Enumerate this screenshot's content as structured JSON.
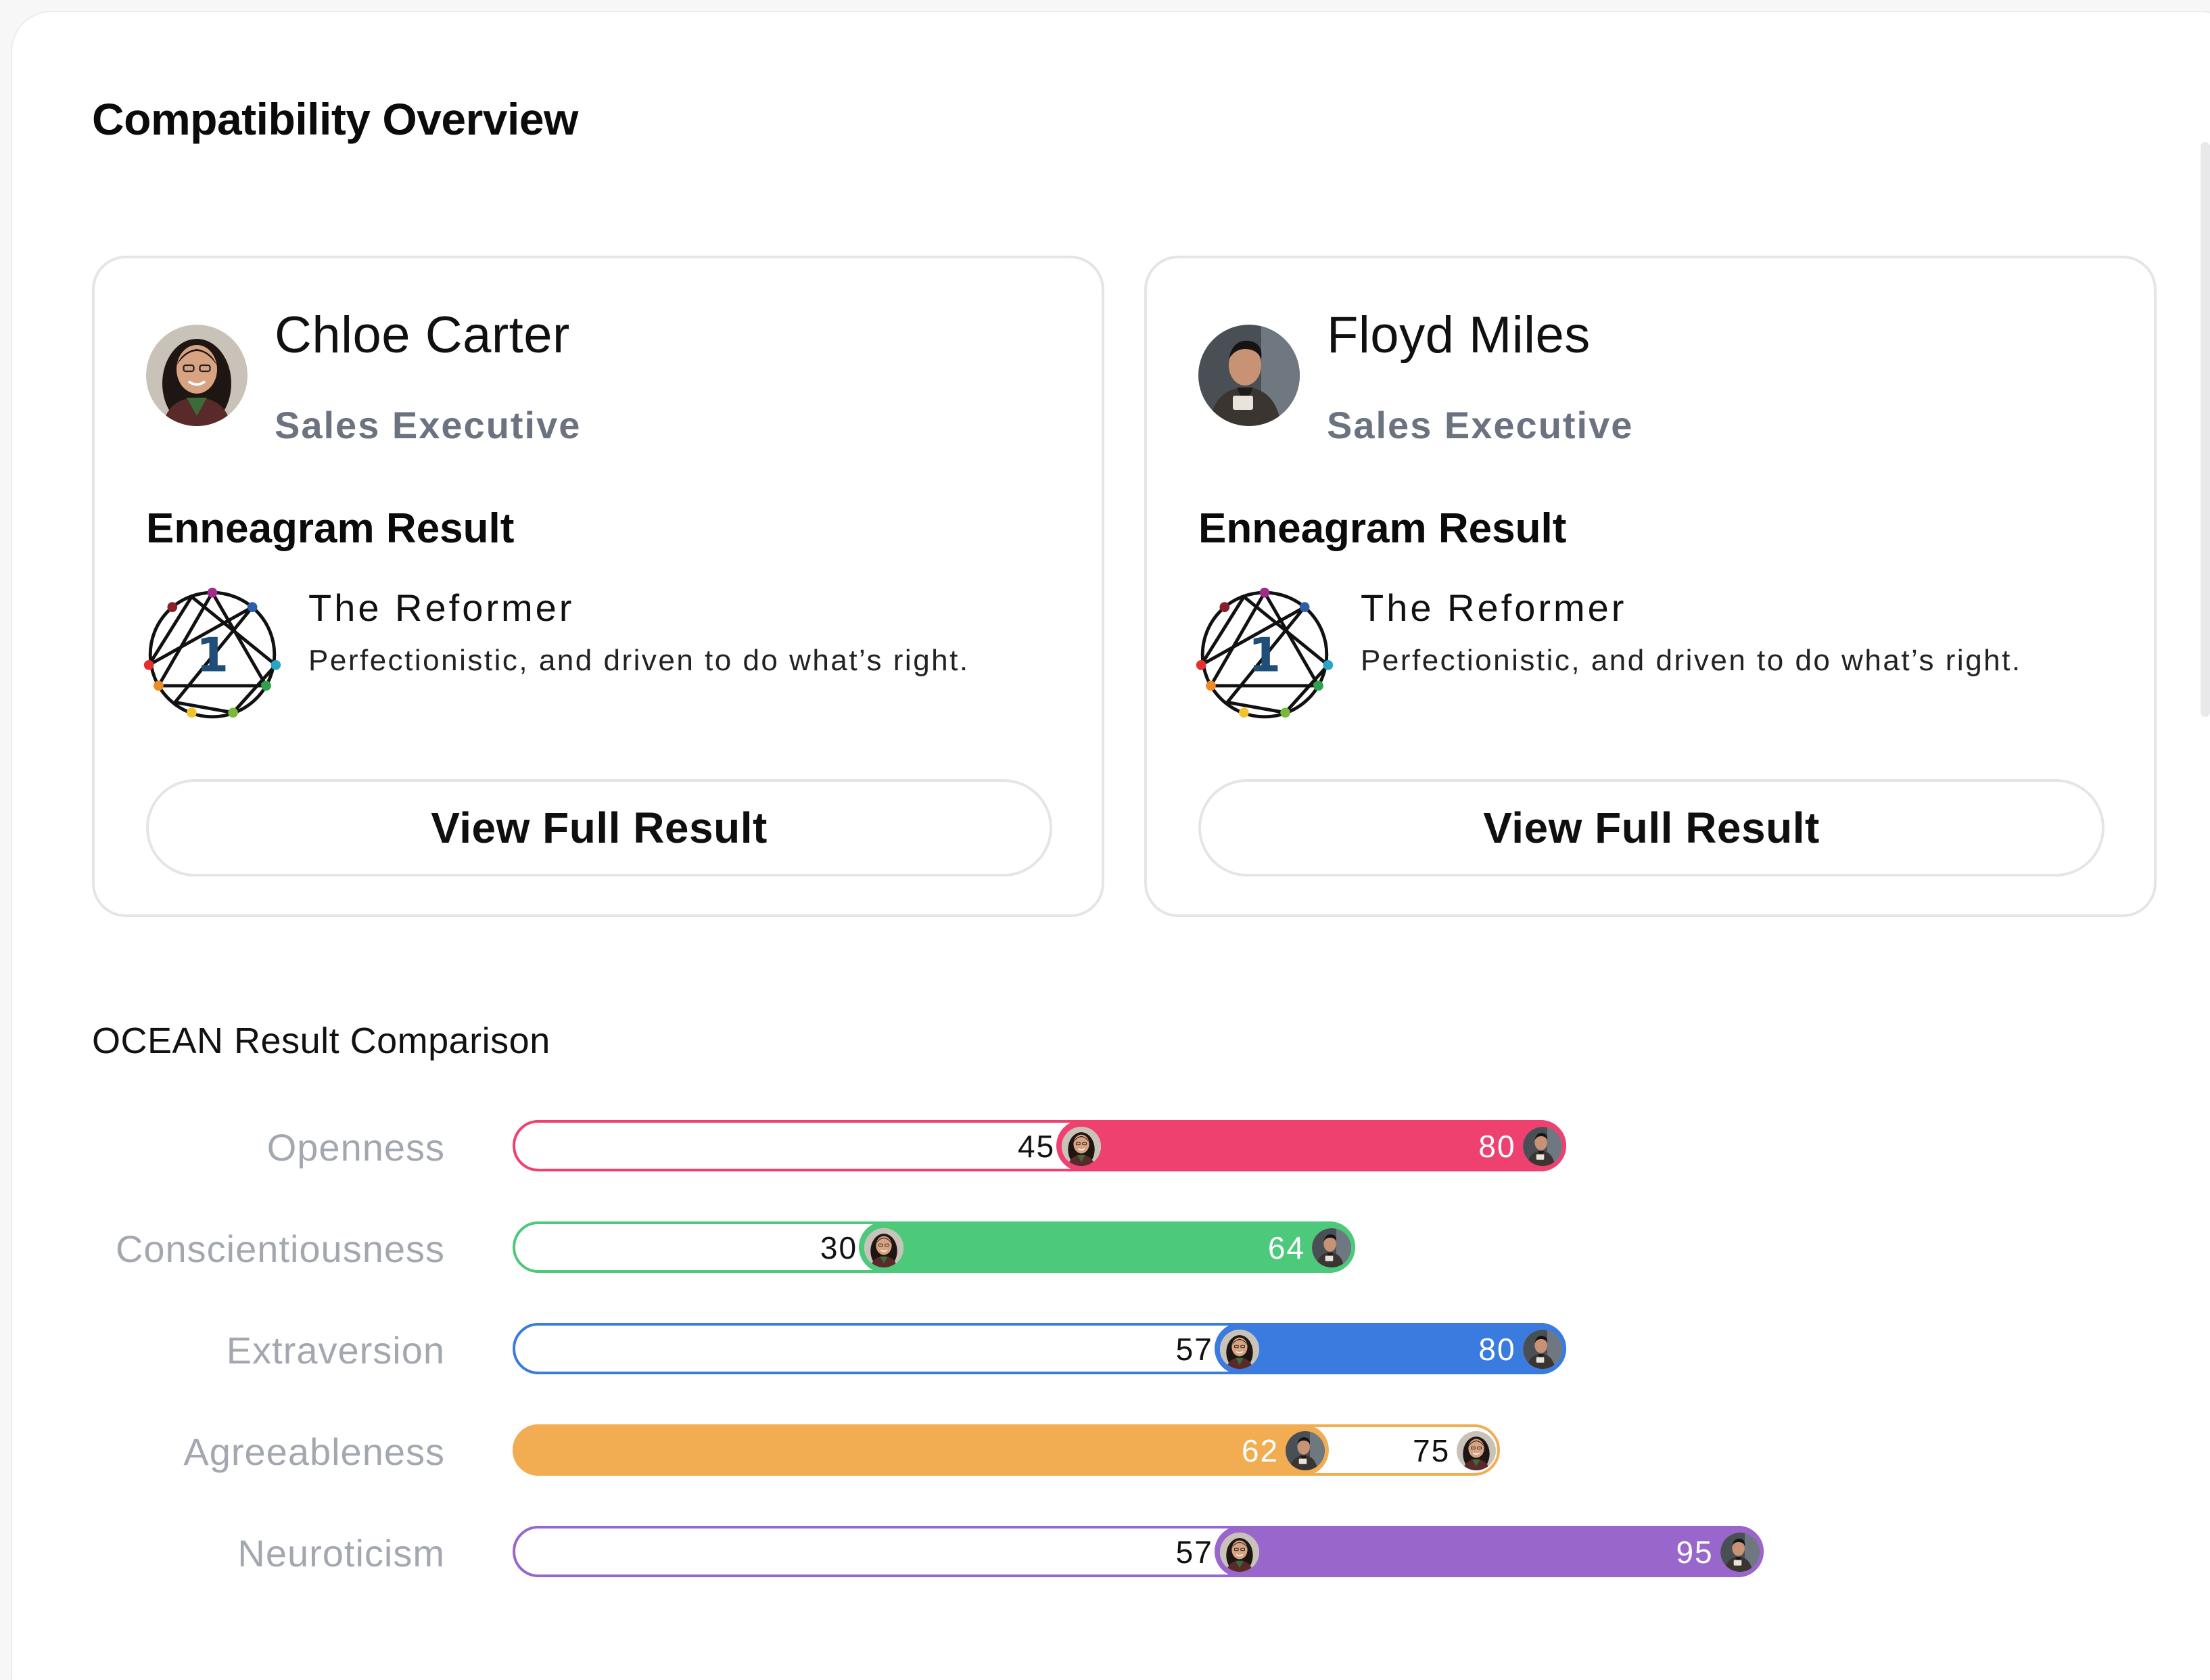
{
  "page": {
    "title": "Compatibility Overview"
  },
  "people": [
    {
      "name": "Chloe Carter",
      "role": "Sales Executive",
      "section_title": "Enneagram Result",
      "enneagram": {
        "number": "1",
        "type": "The Reformer",
        "description": "Perfectionistic, and driven to do what’s right."
      },
      "button_label": "View Full Result"
    },
    {
      "name": "Floyd Miles",
      "role": "Sales Executive",
      "section_title": "Enneagram Result",
      "enneagram": {
        "number": "1",
        "type": "The Reformer",
        "description": "Perfectionistic, and driven to do what’s right."
      },
      "button_label": "View Full Result"
    }
  ],
  "ocean": {
    "title": "OCEAN Result Comparison",
    "scale_max": 100,
    "traits": [
      {
        "name": "Openness",
        "color": "#ee4170",
        "chloe": "45",
        "floyd": "80"
      },
      {
        "name": "Conscientiousness",
        "color": "#4cc97a",
        "chloe": "30",
        "floyd": "64"
      },
      {
        "name": "Extraversion",
        "color": "#3a7be0",
        "chloe": "57",
        "floyd": "80"
      },
      {
        "name": "Agreeableness",
        "color": "#f2ad52",
        "chloe": "75",
        "floyd": "62"
      },
      {
        "name": "Neuroticism",
        "color": "#9966cc",
        "chloe": "57",
        "floyd": "95"
      }
    ]
  },
  "icons": {
    "enneagram": "enneagram-symbol-icon",
    "avatar_chloe": "avatar-chloe",
    "avatar_floyd": "avatar-floyd"
  }
}
